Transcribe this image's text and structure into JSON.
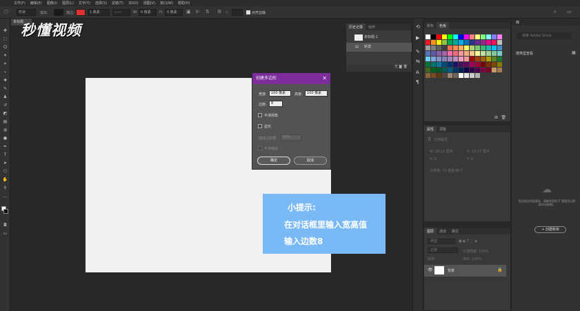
{
  "menu": [
    "文件(F)",
    "编辑(E)",
    "图像(I)",
    "图层(L)",
    "文字(Y)",
    "选择(S)",
    "滤镜(T)",
    "3D(D)",
    "视图(V)",
    "窗口(W)",
    "帮助(H)"
  ],
  "options": {
    "shape_label": "形状",
    "fill_label": "填充:",
    "stroke_label": "描边:",
    "stroke_width": "1 像素",
    "w_label": "W:",
    "w_value": "0 像素",
    "h_label": "H:",
    "h_value": "0 像素",
    "align_edges": "对齐边缘"
  },
  "doc_tab": "未标题",
  "watermark": "秒懂视频",
  "dialog": {
    "title": "创建多边形",
    "width_label": "宽度:",
    "width_value": "100 像素",
    "height_label": "高度:",
    "height_value": "100 像素",
    "sides_label": "边数:",
    "sides_value": "8",
    "smooth_corners": "平滑拐角",
    "star": "星形",
    "indent_label": "缩进边依据:",
    "indent_value": "50%",
    "smooth_indents": "平滑缩进",
    "ok": "确定",
    "cancel": "取消"
  },
  "tip": {
    "title": "小提示:",
    "line1": "在对话框里输入宽高值",
    "line2": "输入边数8"
  },
  "history": {
    "tabs": [
      "历史记录",
      "动作"
    ],
    "snapshot": "未标题-1",
    "step": "新建"
  },
  "swatches": {
    "tabs": [
      "颜色",
      "色板"
    ],
    "colors": [
      "#ffffff",
      "#000000",
      "#ff0000",
      "#ffff00",
      "#00ff00",
      "#00ffff",
      "#0000ff",
      "#ff00ff",
      "#ff8080",
      "#ffff80",
      "#80ff80",
      "#80ffff",
      "#8080ff",
      "#ff80ff",
      "#ed1c24",
      "#f7941d",
      "#fff200",
      "#8dc63f",
      "#00a651",
      "#00a99d",
      "#00aeef",
      "#0072bc",
      "#2e3192",
      "#662d91",
      "#92278f",
      "#ec008c",
      "#ed145b",
      "#c2c2c2",
      "#a0a0a0",
      "#808080",
      "#606060",
      "#404040",
      "#f26c4f",
      "#f68e55",
      "#fbaf5c",
      "#fff568",
      "#acd372",
      "#7cc576",
      "#3bb878",
      "#1abbb4",
      "#00bff3",
      "#438ccb",
      "#5574b9",
      "#605ca8",
      "#855fa8",
      "#a763a8",
      "#f06ea9",
      "#f26d7d",
      "#f5989d",
      "#f9ad81",
      "#fdc68a",
      "#fff799",
      "#c4df9b",
      "#a3d39c",
      "#82ca9c",
      "#7accc8",
      "#6dcff6",
      "#7da7d8",
      "#8393ca",
      "#8781bd",
      "#a186be",
      "#bc8dbf",
      "#f49ac1",
      "#f5989d",
      "#9e0b0f",
      "#a0410d",
      "#a36209",
      "#aba000",
      "#598527",
      "#1a7b30",
      "#007236",
      "#00746b",
      "#0076a3",
      "#004a80",
      "#003471",
      "#1b1464",
      "#440e62",
      "#630460",
      "#9e005d",
      "#9e0039",
      "#790000",
      "#7b2e00",
      "#7d4900",
      "#827b00",
      "#406618",
      "#005e20",
      "#005826",
      "#005952",
      "#005b7f",
      "#003663",
      "#002157",
      "#0d004c",
      "#32004b",
      "#4b0049",
      "#7b0046",
      "#7a0026",
      "#c69c6d",
      "#a67c52",
      "#8c6239",
      "#754c24",
      "#603913",
      "#534741",
      "#998675",
      "#736357",
      "#ffffff",
      "#e6e6e6",
      "#cccccc",
      "#b3b3b3"
    ]
  },
  "properties": {
    "tabs": [
      "属性",
      "调整"
    ],
    "doc_label": "文档属性",
    "w": "W: 28.22 厘米",
    "h": "H: 15.17 厘米",
    "x": "X: 0",
    "y": "Y: 0",
    "resolution": "分辨率: 72 像素/英寸"
  },
  "layers": {
    "tabs": [
      "图层",
      "通道",
      "路径"
    ],
    "kind": "类型",
    "mode": "正常",
    "opacity": "不透明度: 100%",
    "lock": "锁定:",
    "fill": "填充: 100%",
    "layer_name": "背景"
  },
  "library": {
    "tab": "库",
    "search_placeholder": "搜索 Adobe Stock",
    "filter": "按类型查看",
    "message": "您无权访问此服务，请联系您的 IT 管理员以获取访问权限。",
    "button": "+ 创建新库"
  }
}
